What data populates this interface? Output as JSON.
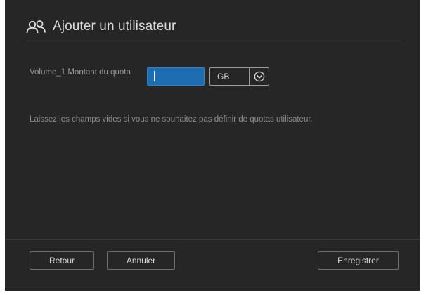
{
  "dialog": {
    "title": "Ajouter un utilisateur",
    "title_icon": "users-icon"
  },
  "quota": {
    "label": "Volume_1 Montant du quota",
    "value": "",
    "unit": "GB",
    "dropdown_icon": "chevron-down-circle-icon"
  },
  "hint": "Laissez les champs vides si vous ne souhaitez pas définir de quotas utilisateur.",
  "buttons": {
    "back": "Retour",
    "cancel": "Annuler",
    "save": "Enregistrer"
  },
  "colors": {
    "background": "#262626",
    "accent": "#1e6db2",
    "text": "#dcdcdc"
  }
}
